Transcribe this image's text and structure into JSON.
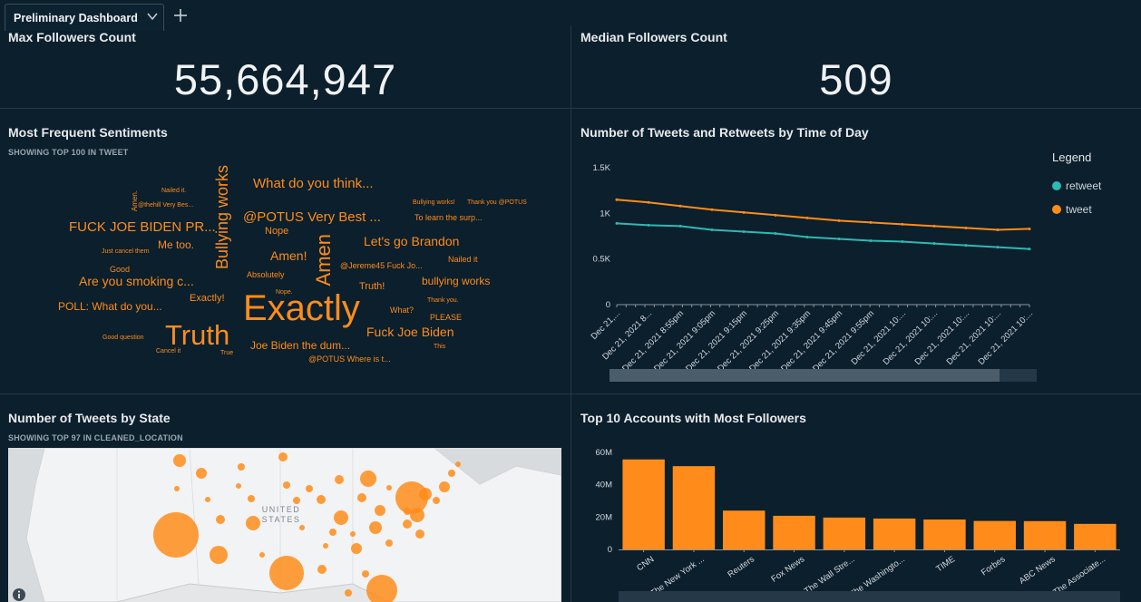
{
  "tab": {
    "label": "Preliminary Dashboard"
  },
  "kpis": [
    {
      "title": "Max Followers Count",
      "value": "55,664,947"
    },
    {
      "title": "Median Followers Count",
      "value": "509"
    }
  ],
  "sentiments": {
    "title": "Most Frequent Sentiments",
    "subtitle": "SHOWING TOP 100 IN TWEET",
    "words": [
      "Exactly",
      "Truth",
      "Amen",
      "Bullying works",
      "FUCK JOE BIDEN PR...",
      "@POTUS Very Best ...",
      "What do you think...",
      "Let's go Brandon",
      "Fuck Joe Biden",
      "Are you smoking c...",
      "POLL: What do you...",
      "Joe Biden the dum...",
      "Amen!",
      "bullying works",
      "Me too.",
      "Exactly!",
      "Nope",
      "Absolutely",
      "@Jereme45 Fuck Jo...",
      "Nailed it",
      "Truth!",
      "@POTUS Where is t...",
      "PLEASE",
      "What?",
      "Good",
      "To learn the surp...",
      "Just cancel them",
      "@thehill Very Bes...",
      "Nailed it.",
      "Amen.",
      "Good question",
      "Cancel it",
      "True",
      "Thank you.",
      "Bullying works!",
      "Thank you @POTUS",
      "This",
      "Nope."
    ]
  },
  "line_chart": {
    "title": "Number of Tweets and Retweets by Time of Day",
    "legend_title": "Legend",
    "y_ticks": [
      "1.5K",
      "1K",
      "0.5K",
      "0"
    ],
    "x_ticks": [
      "Dec 21,...",
      "Dec 21, 2021 8...",
      "Dec 21, 2021 8:55pm",
      "Dec 21, 2021 9:05pm",
      "Dec 21, 2021 9:15pm",
      "Dec 21, 2021 9:25pm",
      "Dec 21, 2021 9:35pm",
      "Dec 21, 2021 9:45pm",
      "Dec 21, 2021 9:55pm",
      "Dec 21, 2021 10:...",
      "Dec 21, 2021 10:...",
      "Dec 21, 2021 10:...",
      "Dec 21, 2021 10:...",
      "Dec 21, 2021 10:..."
    ]
  },
  "state_map": {
    "title": "Number of Tweets by State",
    "subtitle": "SHOWING TOP 97 IN CLEANED_LOCATION",
    "country_label": "UNITED\nSTATES",
    "country_line1": "UNITED",
    "country_line2": "STATES"
  },
  "bar_panel": {
    "title": "Top 10 Accounts with Most Followers"
  },
  "chart_data": [
    {
      "type": "line",
      "title": "Number of Tweets and Retweets by Time of Day",
      "x": [
        "Dec 21,...",
        "Dec 21, 2021 8...",
        "Dec 21, 2021 8:55pm",
        "Dec 21, 2021 9:05pm",
        "Dec 21, 2021 9:15pm",
        "Dec 21, 2021 9:25pm",
        "Dec 21, 2021 9:35pm",
        "Dec 21, 2021 9:45pm",
        "Dec 21, 2021 9:55pm",
        "Dec 21, 2021 10:...",
        "Dec 21, 2021 10:...",
        "Dec 21, 2021 10:...",
        "Dec 21, 2021 10:...",
        "Dec 21, 2021 10:..."
      ],
      "ylim": [
        0,
        1500
      ],
      "legend_position": "right",
      "grid": false,
      "series": [
        {
          "name": "retweet",
          "color": "#2fb8b4",
          "values": [
            890,
            870,
            860,
            820,
            800,
            780,
            740,
            720,
            700,
            690,
            670,
            650,
            630,
            610
          ]
        },
        {
          "name": "tweet",
          "color": "#ff8c1a",
          "values": [
            1150,
            1120,
            1080,
            1040,
            1010,
            980,
            950,
            920,
            900,
            880,
            860,
            840,
            820,
            830
          ]
        }
      ]
    },
    {
      "type": "bar",
      "title": "Top 10 Accounts with Most Followers",
      "categories": [
        "CNN",
        "The New York ...",
        "Reuters",
        "Fox News",
        "The Wall Stre...",
        "The Washingto...",
        "TIME",
        "Forbes",
        "ABC News",
        "The Associate..."
      ],
      "values": [
        55664947,
        51500000,
        24000000,
        20800000,
        19700000,
        19100000,
        18500000,
        17600000,
        17500000,
        15800000
      ],
      "y_ticks": [
        "60M",
        "40M",
        "20M",
        "0"
      ],
      "ylim": [
        0,
        60000000
      ],
      "color": "#ff8c1a"
    }
  ]
}
